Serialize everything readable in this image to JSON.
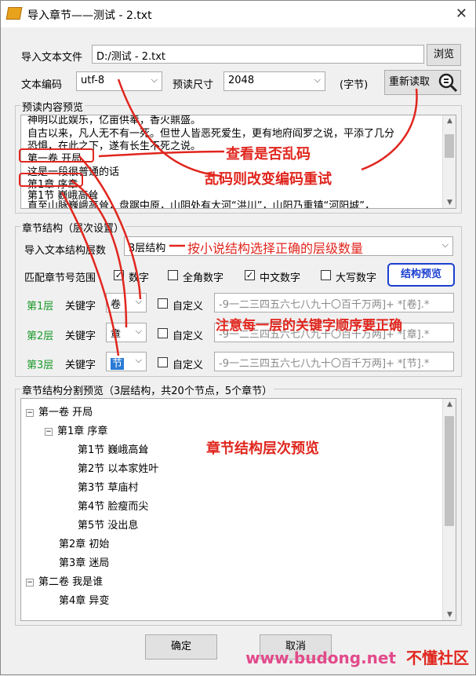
{
  "window": {
    "title": "导入章节——测试 - 2.txt",
    "close_glyph": "✕"
  },
  "file": {
    "label": "导入文本文件",
    "value": "D:/测试 - 2.txt",
    "browse": "浏览"
  },
  "encoding": {
    "label": "文本编码",
    "value": "utf-8",
    "size_label": "预读尺寸",
    "size_value": "2048",
    "unit": "(字节)",
    "reread": "重新读取"
  },
  "preview": {
    "group_title": "预读内容预览",
    "lines": [
      "神明以此娱乐，亿亩供奉，香火鼎盛。",
      "自古以来，凡人无不有一死。但世人皆恶死爱生，更有地府阎罗之说，平添了几分",
      "恐惧，在此之下，遂有长生不死之说。",
      "第一卷 开局",
      "这是一段很普通的话",
      "第1章 序章",
      "第1节 巍峨高耸",
      "直至山脉巍峨高耸，盘踞中原，山阴处有大河“洪川”，山阳乃重镇“河阳城”，"
    ]
  },
  "structure": {
    "group_title": "章节结构（层次设置）",
    "levels_label": "导入文本结构层数",
    "levels_value": "3层结构",
    "range_label": "匹配章节号范围",
    "opts": [
      {
        "label": "数字",
        "checked": "✓"
      },
      {
        "label": "全角数字",
        "checked": ""
      },
      {
        "label": "中文数字",
        "checked": "✓"
      },
      {
        "label": "大写数字",
        "checked": ""
      }
    ],
    "preview_btn": "结构预览",
    "rows": [
      {
        "level": "第1层",
        "kw_label": "关键字",
        "kw": "卷",
        "custom": "自定义",
        "regex": "-9一二三四五六七八九十〇百千万两]+ *[卷].*"
      },
      {
        "level": "第2层",
        "kw_label": "关键字",
        "kw": "章",
        "custom": "自定义",
        "regex": "-9一二三四五六七八九十〇百千万两]+ *[章].*"
      },
      {
        "level": "第3层",
        "kw_label": "关键字",
        "kw": "节",
        "custom": "自定义",
        "regex": "-9一二三四五六七八九十〇百千万两]+ *[节].*"
      }
    ]
  },
  "tree": {
    "group_title": "章节结构分割预览（3层结构，共20个节点，5个章节）",
    "toggle_open": "−",
    "nodes": [
      {
        "text": "第一卷 开局",
        "toggle": true
      },
      {
        "text": "第1章 序章",
        "toggle": true
      },
      {
        "text": "第1节 巍峨高耸",
        "toggle": false
      },
      {
        "text": "第2节 以本家姓叶",
        "toggle": false
      },
      {
        "text": "第3节 草庙村",
        "toggle": false
      },
      {
        "text": "第4节 脸瘦而尖",
        "toggle": false
      },
      {
        "text": "第5节 没出息",
        "toggle": false
      },
      {
        "text": "第2章 初始",
        "toggle": false
      },
      {
        "text": "第3章 迷局",
        "toggle": false
      },
      {
        "text": "第二卷 我是谁",
        "toggle": true
      },
      {
        "text": "第4章 异变",
        "toggle": false
      }
    ]
  },
  "footer": {
    "ok": "确定",
    "cancel": "取消"
  },
  "annotations": {
    "check_garbled": "查看是否乱码",
    "change_encoding": "乱码则改变编码重试",
    "choose_levels": "按小说结构选择正确的层级数量",
    "keyword_order": "注意每一层的关键字顺序要正确",
    "tree_preview": "章节结构层次预览"
  },
  "watermark": {
    "site": "www.budong.net",
    "brand": "不懂社区"
  },
  "colors": {
    "annotation": "#e0261e",
    "level_green": "#1a9a2a",
    "preview_blue": "#1a3fd0"
  },
  "icons": [
    "app-icon",
    "magnifier-icon",
    "close-icon",
    "chevron-down-icon"
  ]
}
